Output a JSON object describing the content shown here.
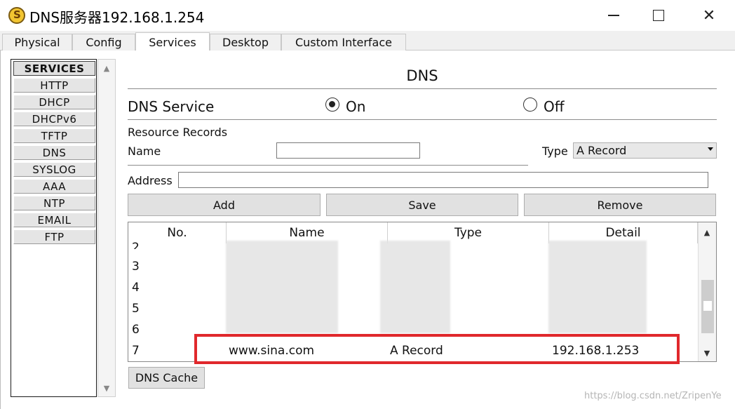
{
  "window": {
    "title": "DNS服务器192.168.1.254",
    "icon": "packet-tracer-server-icon"
  },
  "tabs": [
    {
      "label": "Physical",
      "active": false
    },
    {
      "label": "Config",
      "active": false
    },
    {
      "label": "Services",
      "active": true
    },
    {
      "label": "Desktop",
      "active": false
    },
    {
      "label": "Custom Interface",
      "active": false
    }
  ],
  "services": {
    "header": "SERVICES",
    "items": [
      "HTTP",
      "DHCP",
      "DHCPv6",
      "TFTP",
      "DNS",
      "SYSLOG",
      "AAA",
      "NTP",
      "EMAIL",
      "FTP"
    ]
  },
  "dns": {
    "heading": "DNS",
    "service_label": "DNS Service",
    "on_label": "On",
    "off_label": "Off",
    "service_state": "On",
    "resource_records_label": "Resource Records",
    "name_label": "Name",
    "name_value": "",
    "type_label": "Type",
    "type_value": "A Record",
    "address_label": "Address",
    "address_value": "",
    "add_label": "Add",
    "save_label": "Save",
    "remove_label": "Remove",
    "cache_label": "DNS Cache"
  },
  "table": {
    "columns": [
      "No.",
      "Name",
      "Type",
      "Detail"
    ],
    "rows": [
      {
        "no": "2",
        "name": "",
        "type": "",
        "detail": ""
      },
      {
        "no": "3",
        "name": "",
        "type": "",
        "detail": ""
      },
      {
        "no": "4",
        "name": "",
        "type": "",
        "detail": ""
      },
      {
        "no": "5",
        "name": "",
        "type": "",
        "detail": ""
      },
      {
        "no": "6",
        "name": "",
        "type": "",
        "detail": ""
      },
      {
        "no": "7",
        "name": "www.sina.com",
        "type": "A Record",
        "detail": "192.168.1.253"
      }
    ]
  },
  "colors": {
    "highlight_border": "#e0282c"
  },
  "watermark": "https://blog.csdn.net/ZripenYe"
}
